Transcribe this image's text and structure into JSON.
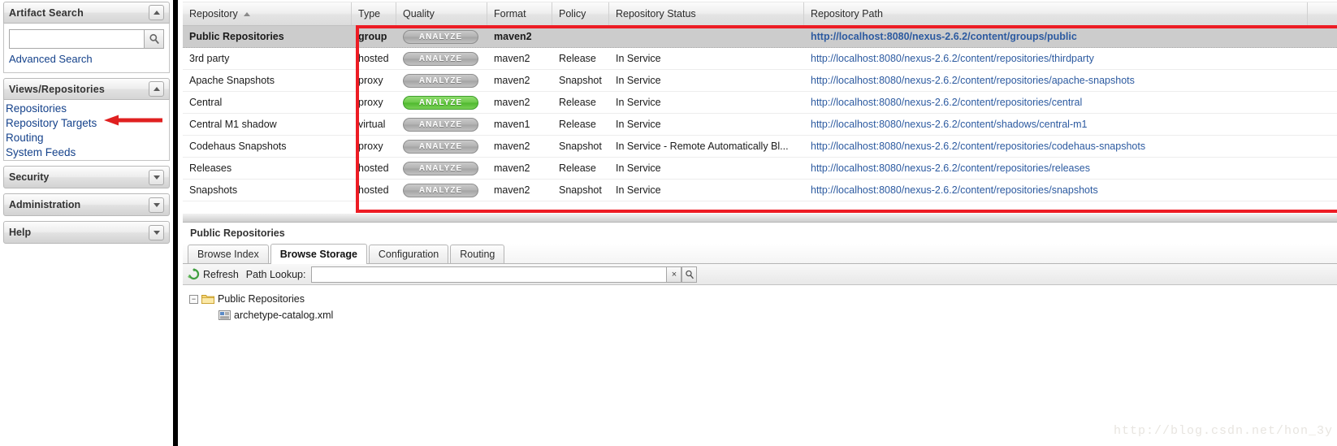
{
  "sidebar": {
    "artifact_search": {
      "title": "Artifact Search",
      "collapse_icon": "chevron-up-icon",
      "search_value": "",
      "search_placeholder": "",
      "search_icon": "magnifier-icon",
      "advanced_search_label": "Advanced Search"
    },
    "views_repositories": {
      "title": "Views/Repositories",
      "collapse_icon": "chevron-up-icon",
      "items": [
        {
          "label": "Repositories"
        },
        {
          "label": "Repository Targets"
        },
        {
          "label": "Routing"
        },
        {
          "label": "System Feeds"
        }
      ]
    },
    "collapsed_sections": [
      {
        "label": "Security",
        "expand_icon": "chevron-down-icon"
      },
      {
        "label": "Administration",
        "expand_icon": "chevron-down-icon"
      },
      {
        "label": "Help",
        "expand_icon": "chevron-down-icon"
      }
    ]
  },
  "grid": {
    "columns": [
      {
        "label": "Repository",
        "sorted": true,
        "sort_dir": "asc"
      },
      {
        "label": "Type"
      },
      {
        "label": "Quality"
      },
      {
        "label": "Format"
      },
      {
        "label": "Policy"
      },
      {
        "label": "Repository Status"
      },
      {
        "label": "Repository Path"
      }
    ],
    "rows": [
      {
        "repository": "Public Repositories",
        "type": "group",
        "quality": "ANALYZE",
        "quality_state": "grey",
        "format": "maven2",
        "policy": "",
        "status": "",
        "path": "http://localhost:8080/nexus-2.6.2/content/groups/public",
        "selected": true
      },
      {
        "repository": "3rd party",
        "type": "hosted",
        "quality": "ANALYZE",
        "quality_state": "grey",
        "format": "maven2",
        "policy": "Release",
        "status": "In Service",
        "path": "http://localhost:8080/nexus-2.6.2/content/repositories/thirdparty",
        "selected": false
      },
      {
        "repository": "Apache Snapshots",
        "type": "proxy",
        "quality": "ANALYZE",
        "quality_state": "grey",
        "format": "maven2",
        "policy": "Snapshot",
        "status": "In Service",
        "path": "http://localhost:8080/nexus-2.6.2/content/repositories/apache-snapshots",
        "selected": false
      },
      {
        "repository": "Central",
        "type": "proxy",
        "quality": "ANALYZE",
        "quality_state": "green",
        "format": "maven2",
        "policy": "Release",
        "status": "In Service",
        "path": "http://localhost:8080/nexus-2.6.2/content/repositories/central",
        "selected": false
      },
      {
        "repository": "Central M1 shadow",
        "type": "virtual",
        "quality": "ANALYZE",
        "quality_state": "grey",
        "format": "maven1",
        "policy": "Release",
        "status": "In Service",
        "path": "http://localhost:8080/nexus-2.6.2/content/shadows/central-m1",
        "selected": false
      },
      {
        "repository": "Codehaus Snapshots",
        "type": "proxy",
        "quality": "ANALYZE",
        "quality_state": "grey",
        "format": "maven2",
        "policy": "Snapshot",
        "status": "In Service - Remote Automatically Bl...",
        "path": "http://localhost:8080/nexus-2.6.2/content/repositories/codehaus-snapshots",
        "selected": false
      },
      {
        "repository": "Releases",
        "type": "hosted",
        "quality": "ANALYZE",
        "quality_state": "grey",
        "format": "maven2",
        "policy": "Release",
        "status": "In Service",
        "path": "http://localhost:8080/nexus-2.6.2/content/repositories/releases",
        "selected": false
      },
      {
        "repository": "Snapshots",
        "type": "hosted",
        "quality": "ANALYZE",
        "quality_state": "grey",
        "format": "maven2",
        "policy": "Snapshot",
        "status": "In Service",
        "path": "http://localhost:8080/nexus-2.6.2/content/repositories/snapshots",
        "selected": false
      }
    ]
  },
  "detail": {
    "title": "Public Repositories",
    "tabs": [
      {
        "label": "Browse Index",
        "active": false
      },
      {
        "label": "Browse Storage",
        "active": true
      },
      {
        "label": "Configuration",
        "active": false
      },
      {
        "label": "Routing",
        "active": false
      }
    ],
    "toolbar": {
      "refresh_label": "Refresh",
      "refresh_icon": "refresh-icon",
      "path_lookup_label": "Path Lookup:",
      "path_lookup_value": "",
      "clear_icon": "x-icon",
      "search_icon": "magnifier-icon"
    },
    "tree": {
      "root": {
        "label": "Public Repositories",
        "icon": "folder-icon",
        "expander": "minus-icon",
        "expanded": true
      },
      "children": [
        {
          "label": "archetype-catalog.xml",
          "icon": "xml-file-icon"
        }
      ]
    }
  },
  "annotations": {
    "red_box": {
      "color": "#ed1c24"
    },
    "red_arrow": {
      "color": "#e02020",
      "points_to": "Repositories"
    }
  },
  "watermark": "http://blog.csdn.net/hon_3y",
  "colors": {
    "link": "#15428b",
    "path_link": "#2c5aa0",
    "annotation_red": "#ed1c24",
    "analyze_green": "#4fb82e",
    "analyze_grey": "#b3b3b3"
  }
}
